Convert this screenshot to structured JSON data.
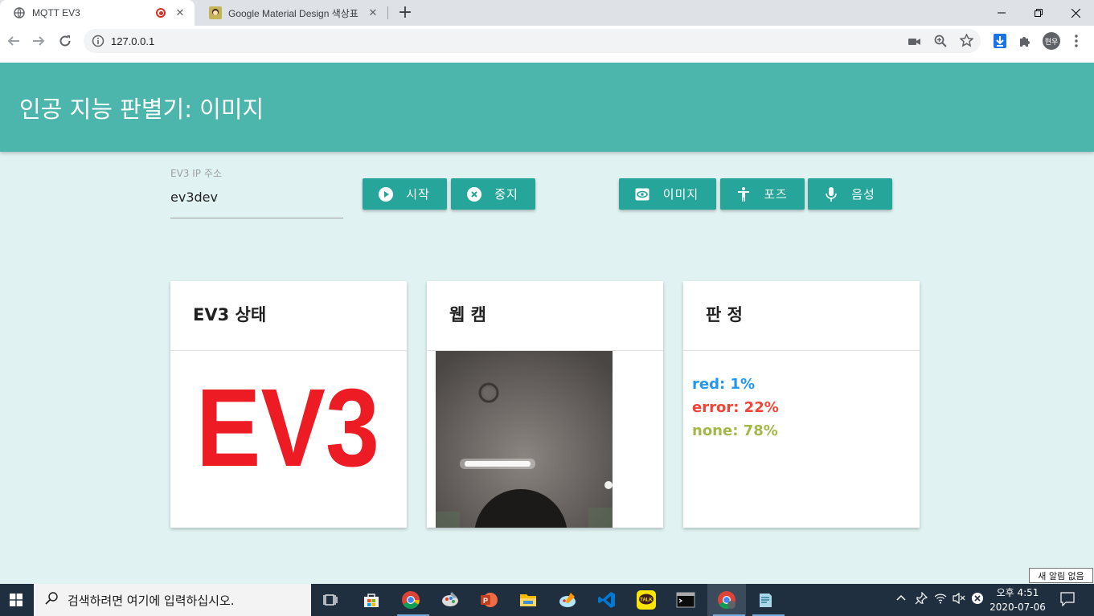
{
  "browser": {
    "tabs": [
      {
        "title": "MQTT EV3",
        "active": true
      },
      {
        "title": "Google Material Design 색상표",
        "active": false
      }
    ],
    "url": "127.0.0.1",
    "profile_label": "현우"
  },
  "app": {
    "header_title": "인공 지능 판별기: 이미지",
    "ip_field": {
      "label": "EV3 IP 주소",
      "value": "ev3dev"
    },
    "buttons": {
      "start": "시작",
      "stop": "중지",
      "image": "이미지",
      "pose": "포즈",
      "voice": "음성"
    },
    "cards": {
      "status_title": "EV3 상태",
      "status_logo_text": "EV3",
      "webcam_title": "웹 캠",
      "judge_title": "판 정",
      "results": [
        {
          "text": "red: 1%",
          "color": "#2196f3"
        },
        {
          "text": "error: 22%",
          "color": "#f44336"
        },
        {
          "text": "none: 78%",
          "color": "#8bc34a"
        }
      ]
    },
    "colors": {
      "header": "#4db6ac",
      "button": "#26a69a",
      "background": "#e0f2f1",
      "logo_red": "#ed1c24"
    }
  },
  "taskbar": {
    "search_placeholder": "검색하려면 여기에 입력하십시오.",
    "time": "오후 4:51",
    "date": "2020-07-06",
    "notification_tooltip": "새 알림 없음"
  }
}
